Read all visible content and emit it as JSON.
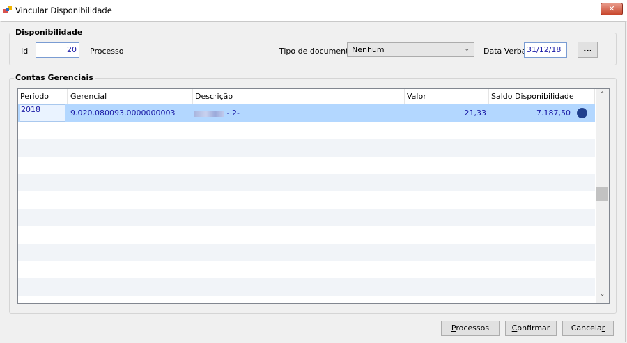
{
  "window": {
    "title": "Vincular Disponibilidade",
    "close_label": "✕"
  },
  "disponibilidade": {
    "legend": "Disponibilidade",
    "id_label": "Id",
    "id_value": "20",
    "processo_label": "Processo",
    "tipo_documento_label": "Tipo de documento",
    "tipo_documento_value": "Nenhum",
    "data_verba_label": "Data Verba",
    "data_verba_value": "31/12/18",
    "ellipsis_button": "..."
  },
  "contas": {
    "legend": "Contas Gerenciais",
    "columns": [
      "Período",
      "Gerencial",
      "Descrição",
      "Valor",
      "Saldo Disponibilidade"
    ],
    "rows": [
      {
        "periodo": "2018",
        "gerencial": "9.020.080093.0000000003",
        "descricao_suffix": "- 2-",
        "valor": "21,33",
        "saldo": "7.187,50"
      }
    ]
  },
  "buttons": {
    "processos_u": "P",
    "processos_rest": "rocessos",
    "confirmar_u": "C",
    "confirmar_rest": "onfirmar",
    "cancelar_pre": "Cancela",
    "cancelar_u": "r"
  },
  "icons": [
    "app-icon",
    "close-icon",
    "chevron-down-icon",
    "status-dot-icon",
    "scroll-up-icon",
    "scroll-down-icon"
  ],
  "colors": {
    "selection": "#b3d7ff",
    "value_text": "#1a1aa6",
    "status_dot": "#1f3f8e",
    "close_button": "#c8462c"
  }
}
